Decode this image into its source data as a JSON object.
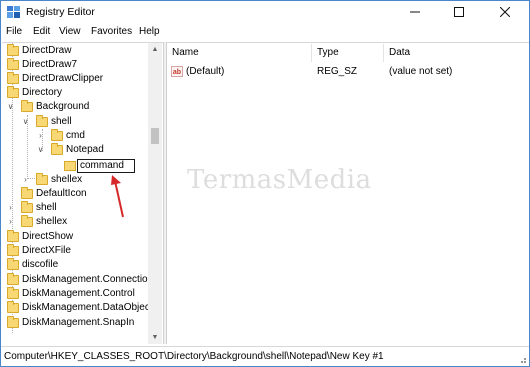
{
  "window": {
    "title": "Registry Editor"
  },
  "menu": {
    "items": [
      "File",
      "Edit",
      "View",
      "Favorites",
      "Help"
    ]
  },
  "tree": {
    "items": [
      {
        "label": "DirectDraw"
      },
      {
        "label": "DirectDraw7"
      },
      {
        "label": "DirectDrawClipper"
      },
      {
        "label": "Directory"
      },
      {
        "label": "Background"
      },
      {
        "label": "shell"
      },
      {
        "label": "cmd"
      },
      {
        "label": "Notepad"
      },
      {
        "label": "shellex"
      },
      {
        "label": "DefaultIcon"
      },
      {
        "label": "shell"
      },
      {
        "label": "shellex"
      },
      {
        "label": "DirectShow"
      },
      {
        "label": "DirectXFile"
      },
      {
        "label": "discofile"
      },
      {
        "label": "DiskManagement.Connection"
      },
      {
        "label": "DiskManagement.Control"
      },
      {
        "label": "DiskManagement.DataObject"
      },
      {
        "label": "DiskManagement.SnapIn"
      }
    ],
    "editing_value": "command"
  },
  "list": {
    "headers": {
      "name": "Name",
      "type": "Type",
      "data": "Data"
    },
    "rows": [
      {
        "name": "(Default)",
        "type": "REG_SZ",
        "data": "(value not set)"
      }
    ]
  },
  "watermark": "TermasMedia",
  "status": {
    "path": "Computer\\HKEY_CLASSES_ROOT\\Directory\\Background\\shell\\Notepad\\New Key #1"
  },
  "colors": {
    "folder": "#f8d775",
    "window_border": "#4a86c8",
    "annotation": "#d62828"
  }
}
